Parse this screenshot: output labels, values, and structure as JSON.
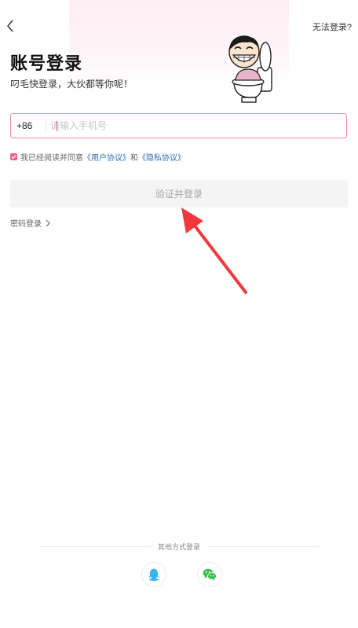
{
  "header": {
    "back_icon": "chevron-left-icon",
    "help_label": "无法登录?"
  },
  "title": "账号登录",
  "subtitle": "叼毛快登录，大伙都等你呢！",
  "phone": {
    "country_code": "+86",
    "placeholder": "请输入手机号",
    "value": ""
  },
  "agreement": {
    "checked": true,
    "prefix": "我已经阅读并同意",
    "user_agreement": "《用户协议》",
    "connector": "和",
    "privacy_policy": "《隐私协议》"
  },
  "submit_label": "验证并登录",
  "password_login_label": "密码登录",
  "other_login": {
    "label": "其他方式登录",
    "providers": [
      "qq-icon",
      "wechat-icon"
    ]
  },
  "colors": {
    "accent": "#f0628f",
    "link": "#2f6cb3",
    "annotation_arrow": "#f0393d",
    "qq": "#35b4f2",
    "wechat": "#3ec24f"
  }
}
